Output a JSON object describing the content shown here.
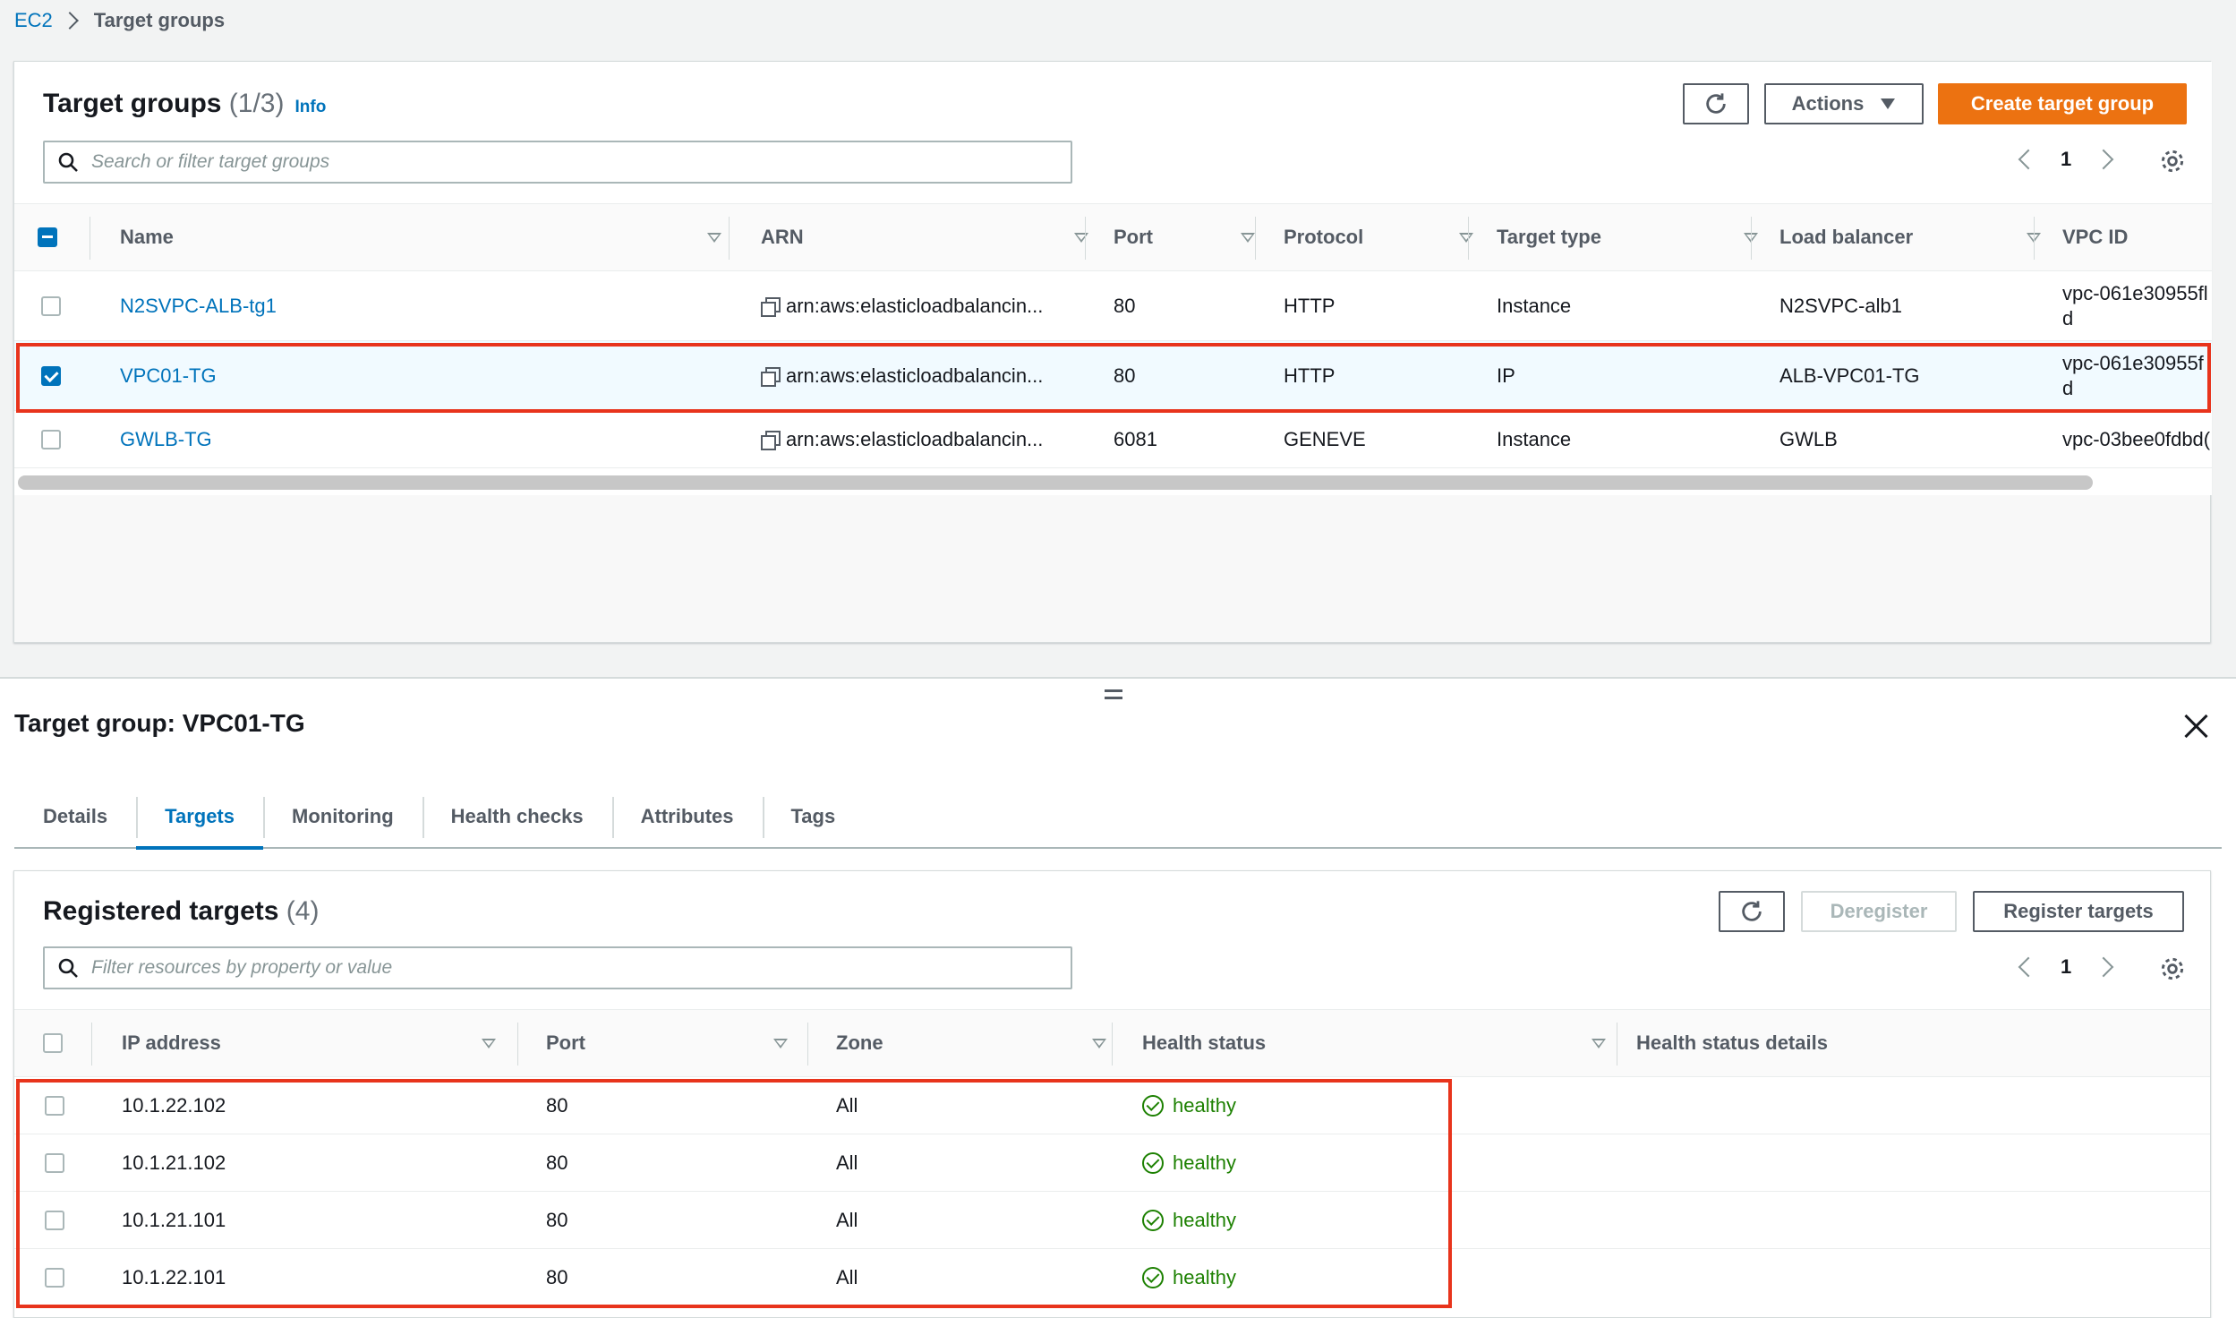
{
  "breadcrumb": {
    "root": "EC2",
    "current": "Target groups"
  },
  "target_groups": {
    "title": "Target groups",
    "count": "(1/3)",
    "info_label": "Info",
    "actions_label": "Actions",
    "create_label": "Create target group",
    "search_placeholder": "Search or filter target groups",
    "page": "1",
    "columns": [
      "Name",
      "ARN",
      "Port",
      "Protocol",
      "Target type",
      "Load balancer",
      "VPC ID"
    ],
    "rows": [
      {
        "name": "N2SVPC-ALB-tg1",
        "arn": "arn:aws:elasticloadbalancin...",
        "port": "80",
        "protocol": "HTTP",
        "target_type": "Instance",
        "load_balancer": "N2SVPC-alb1",
        "vpc_id_1": "vpc-061e30955fl",
        "vpc_id_2": "d",
        "selected": false
      },
      {
        "name": "VPC01-TG",
        "arn": "arn:aws:elasticloadbalancin...",
        "port": "80",
        "protocol": "HTTP",
        "target_type": "IP",
        "load_balancer": "ALB-VPC01-TG",
        "vpc_id_1": "vpc-061e30955f",
        "vpc_id_2": "d",
        "selected": true
      },
      {
        "name": "GWLB-TG",
        "arn": "arn:aws:elasticloadbalancin...",
        "port": "6081",
        "protocol": "GENEVE",
        "target_type": "Instance",
        "load_balancer": "GWLB",
        "vpc_id_1": "vpc-03bee0fdbd(",
        "vpc_id_2": "",
        "selected": false
      }
    ]
  },
  "detail": {
    "title": "Target group: VPC01-TG",
    "tabs": [
      "Details",
      "Targets",
      "Monitoring",
      "Health checks",
      "Attributes",
      "Tags"
    ],
    "active_tab": "Targets"
  },
  "registered_targets": {
    "title": "Registered targets",
    "count": "(4)",
    "deregister_label": "Deregister",
    "register_label": "Register targets",
    "filter_placeholder": "Filter resources by property or value",
    "page": "1",
    "columns": [
      "IP address",
      "Port",
      "Zone",
      "Health status",
      "Health status details"
    ],
    "rows": [
      {
        "ip": "10.1.22.102",
        "port": "80",
        "zone": "All",
        "health": "healthy",
        "details": ""
      },
      {
        "ip": "10.1.21.102",
        "port": "80",
        "zone": "All",
        "health": "healthy",
        "details": ""
      },
      {
        "ip": "10.1.21.101",
        "port": "80",
        "zone": "All",
        "health": "healthy",
        "details": ""
      },
      {
        "ip": "10.1.22.101",
        "port": "80",
        "zone": "All",
        "health": "healthy",
        "details": ""
      }
    ]
  },
  "colors": {
    "accent": "#0073bb",
    "primary_button": "#ec7211",
    "healthy": "#1d8102",
    "highlight_box": "#e8341c"
  },
  "icons": {
    "refresh": "refresh-icon",
    "settings": "gear-icon",
    "search": "search-icon",
    "copy": "copy-icon",
    "close": "close-icon",
    "status_ok": "check-circle-icon"
  }
}
